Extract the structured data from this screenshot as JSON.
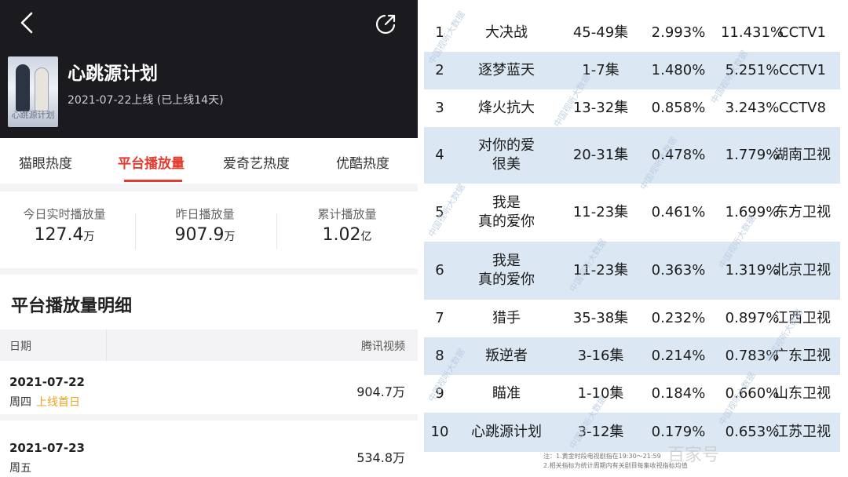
{
  "app": {
    "show_title": "心跳源计划",
    "release": "2021-07-22上线 (已上线14天)",
    "poster_text": "心跳源计划",
    "tabs": [
      "猫眼热度",
      "平台播放量",
      "爱奇艺热度",
      "优酷热度"
    ],
    "active_tab": "平台播放量"
  },
  "stats": [
    {
      "label": "今日实时播放量",
      "value": "127.4",
      "unit": "万"
    },
    {
      "label": "昨日播放量",
      "value": "907.9",
      "unit": "万"
    },
    {
      "label": "累计播放量",
      "value": "1.02",
      "unit": "亿"
    }
  ],
  "detail": {
    "title": "平台播放量明细",
    "col_date": "日期",
    "col_source": "腾讯视频",
    "rows": [
      {
        "date": "2021-07-22",
        "weekday": "周四",
        "tag": "上线首日",
        "amount": "904.7万"
      },
      {
        "date": "2021-07-23",
        "weekday": "周五",
        "tag": "",
        "amount": "534.8万"
      }
    ]
  },
  "ranking": {
    "rows": [
      {
        "rank": "1",
        "name": "大决战",
        "episodes": "45-49集",
        "rating": "2.993%",
        "share": "11.431%",
        "channel": "CCTV1"
      },
      {
        "rank": "2",
        "name": "逐梦蓝天",
        "episodes": "1-7集",
        "rating": "1.480%",
        "share": "5.251%",
        "channel": "CCTV1"
      },
      {
        "rank": "3",
        "name": "烽火抗大",
        "episodes": "13-32集",
        "rating": "0.858%",
        "share": "3.243%",
        "channel": "CCTV8"
      },
      {
        "rank": "4",
        "name": "对你的爱很美",
        "episodes": "20-31集",
        "rating": "0.478%",
        "share": "1.779%",
        "channel": "湖南卫视"
      },
      {
        "rank": "5",
        "name": "我是真的爱你",
        "episodes": "11-23集",
        "rating": "0.461%",
        "share": "1.699%",
        "channel": "东方卫视"
      },
      {
        "rank": "6",
        "name": "我是真的爱你",
        "episodes": "11-23集",
        "rating": "0.363%",
        "share": "1.319%",
        "channel": "北京卫视"
      },
      {
        "rank": "7",
        "name": "猎手",
        "episodes": "35-38集",
        "rating": "0.232%",
        "share": "0.897%",
        "channel": "江西卫视"
      },
      {
        "rank": "8",
        "name": "叛逆者",
        "episodes": "3-16集",
        "rating": "0.214%",
        "share": "0.783%",
        "channel": "广东卫视"
      },
      {
        "rank": "9",
        "name": "瞄准",
        "episodes": "1-10集",
        "rating": "0.184%",
        "share": "0.660%",
        "channel": "山东卫视"
      },
      {
        "rank": "10",
        "name": "心跳源计划",
        "episodes": "3-12集",
        "rating": "0.179%",
        "share": "0.653%",
        "channel": "江苏卫视"
      }
    ],
    "notes": [
      "注：1.黄金时段电视剧指在19:30～21:59",
      "2.相关指标为统计周期内有关剧目每集收视指标均值"
    ],
    "watermark": "中国视听大数据",
    "corner_watermark": "百家号"
  },
  "icons": {
    "back": "back-arrow-icon",
    "share": "share-icon"
  },
  "colors": {
    "accent": "#e23b2f",
    "tag": "#e8a321",
    "hero_bg": "#1b1a1f",
    "table_stripe": "#dbe8f4"
  }
}
